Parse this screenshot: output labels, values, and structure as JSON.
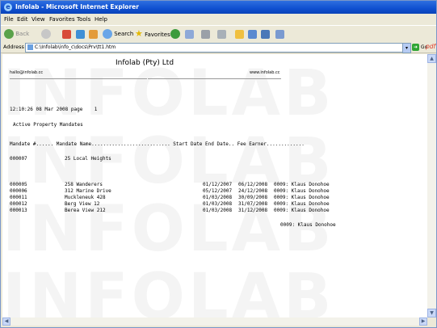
{
  "window": {
    "title": "Infolab - Microsoft Internet Explorer"
  },
  "menu": [
    "File",
    "Edit",
    "View",
    "Favorites",
    "Tools",
    "Help"
  ],
  "toolbar": {
    "back_label": "Back",
    "search_label": "Search",
    "favorites_label": "Favorites"
  },
  "address": {
    "label": "Address",
    "url": "C:\\Infolab\\info_c\\docs\\Prv\\tt1.htm",
    "go_label": "Go",
    "pdf_label": "pdf"
  },
  "report": {
    "company": "Infolab (Pty) Ltd",
    "email": "hallo@infolab.cc",
    "website": "www.infolab.cc",
    "datetime_line": "12:10:26 08 Mar 2008 page    1",
    "report_title": "Active Property Mandates",
    "header_line": "Mandate #...... Mandate Name........................... Start Date End Date.. Fee Earner.............",
    "group_row": {
      "mandate_no": "000007",
      "name": "25 Local Heights"
    },
    "rows": [
      {
        "mandate_no": "000005",
        "name": "258 Wanderers",
        "start": "01/12/2007",
        "end": "06/12/2008",
        "earner": "0009: Klaus Donohoe"
      },
      {
        "mandate_no": "000006",
        "name": "312 Marine Drive",
        "start": "05/12/2007",
        "end": "24/12/2008",
        "earner": "0009: Klaus Donohoe"
      },
      {
        "mandate_no": "000011",
        "name": "Muckleneuk 428",
        "start": "01/03/2008",
        "end": "30/09/2008",
        "earner": "0009: Klaus Donohoe"
      },
      {
        "mandate_no": "000012",
        "name": "Berg View 12",
        "start": "01/03/2008",
        "end": "31/07/2008",
        "earner": "0009: Klaus Donohoe"
      },
      {
        "mandate_no": "000013",
        "name": "Berea View 212",
        "start": "01/03/2008",
        "end": "31/12/2008",
        "earner": "0009: Klaus Donohoe"
      }
    ],
    "footer_earner": "0009: Klaus Donohoe",
    "watermark": "INFOLAB"
  },
  "colors": {
    "titlebar": "#0f4fd0",
    "chrome": "#ece9d8",
    "watermark": "#969696"
  }
}
